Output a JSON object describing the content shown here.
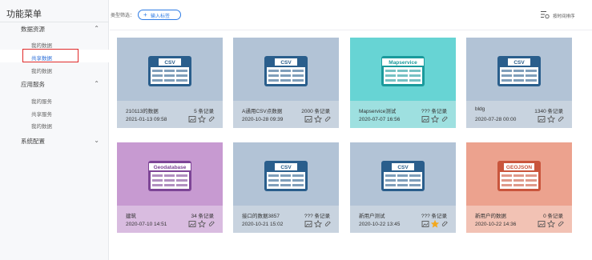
{
  "sidebar": {
    "title": "功能菜单",
    "groups": [
      {
        "label": "数据资源",
        "items": [
          "我的数据",
          "共享数据",
          "我的数据"
        ]
      },
      {
        "label": "应用服务",
        "items": [
          "我的服务",
          "共享服务",
          "我的数据"
        ]
      },
      {
        "label": "系统配置"
      }
    ]
  },
  "toolbar": {
    "filter_label": "类型筛选：",
    "add_tag_label": "输入标签",
    "tools_label": "按时间排序"
  },
  "cards": [
    {
      "badge": "CSV",
      "name": "210113的数据",
      "count": "5 条记录",
      "date": "2021-01-13 09:58",
      "starred": false
    },
    {
      "badge": "CSV",
      "name": "A通用CSV点数据",
      "count": "2000 条记录",
      "date": "2020-10-28 09:39",
      "starred": false
    },
    {
      "badge": "Mapservice",
      "name": "Mapservice测试",
      "count": "??? 条记录",
      "date": "2020-07-07 16:56",
      "starred": false
    },
    {
      "badge": "CSV",
      "name": "bldg",
      "count": "1340 条记录",
      "date": "2020-07-28 00:00",
      "starred": false
    },
    {
      "badge": "Geodatabase",
      "name": "建筑",
      "count": "34 条记录",
      "date": "2020-07-10 14:51",
      "starred": false
    },
    {
      "badge": "CSV",
      "name": "接口的数据3857",
      "count": "??? 条记录",
      "date": "2020-10-21 15:02",
      "starred": false
    },
    {
      "badge": "CSV",
      "name": "新用户测试",
      "count": "??? 条记录",
      "date": "2020-10-22 13:45",
      "starred": true
    },
    {
      "badge": "GEOJSON",
      "name": "新用户的数据",
      "count": "0 条记录",
      "date": "2020-10-22 14:36",
      "starred": false
    }
  ],
  "colors": {
    "csv_top": "#b2c3d6",
    "csv_bot": "#c8d3df",
    "csv_icon": "#2a5e8c",
    "mapservice_top": "#67d4d4",
    "mapservice_bot": "#9ee0e0",
    "mapservice_icon": "#1a9a9c",
    "geodatabase_top": "#c79ad1",
    "geodatabase_bot": "#d9bce0",
    "geodatabase_icon": "#7d4596",
    "geojson_top": "#eca28e",
    "geojson_bot": "#f2c2b4",
    "geojson_icon": "#c9553c",
    "star_active": "#f3a81c",
    "highlight": "#e02a2a"
  }
}
